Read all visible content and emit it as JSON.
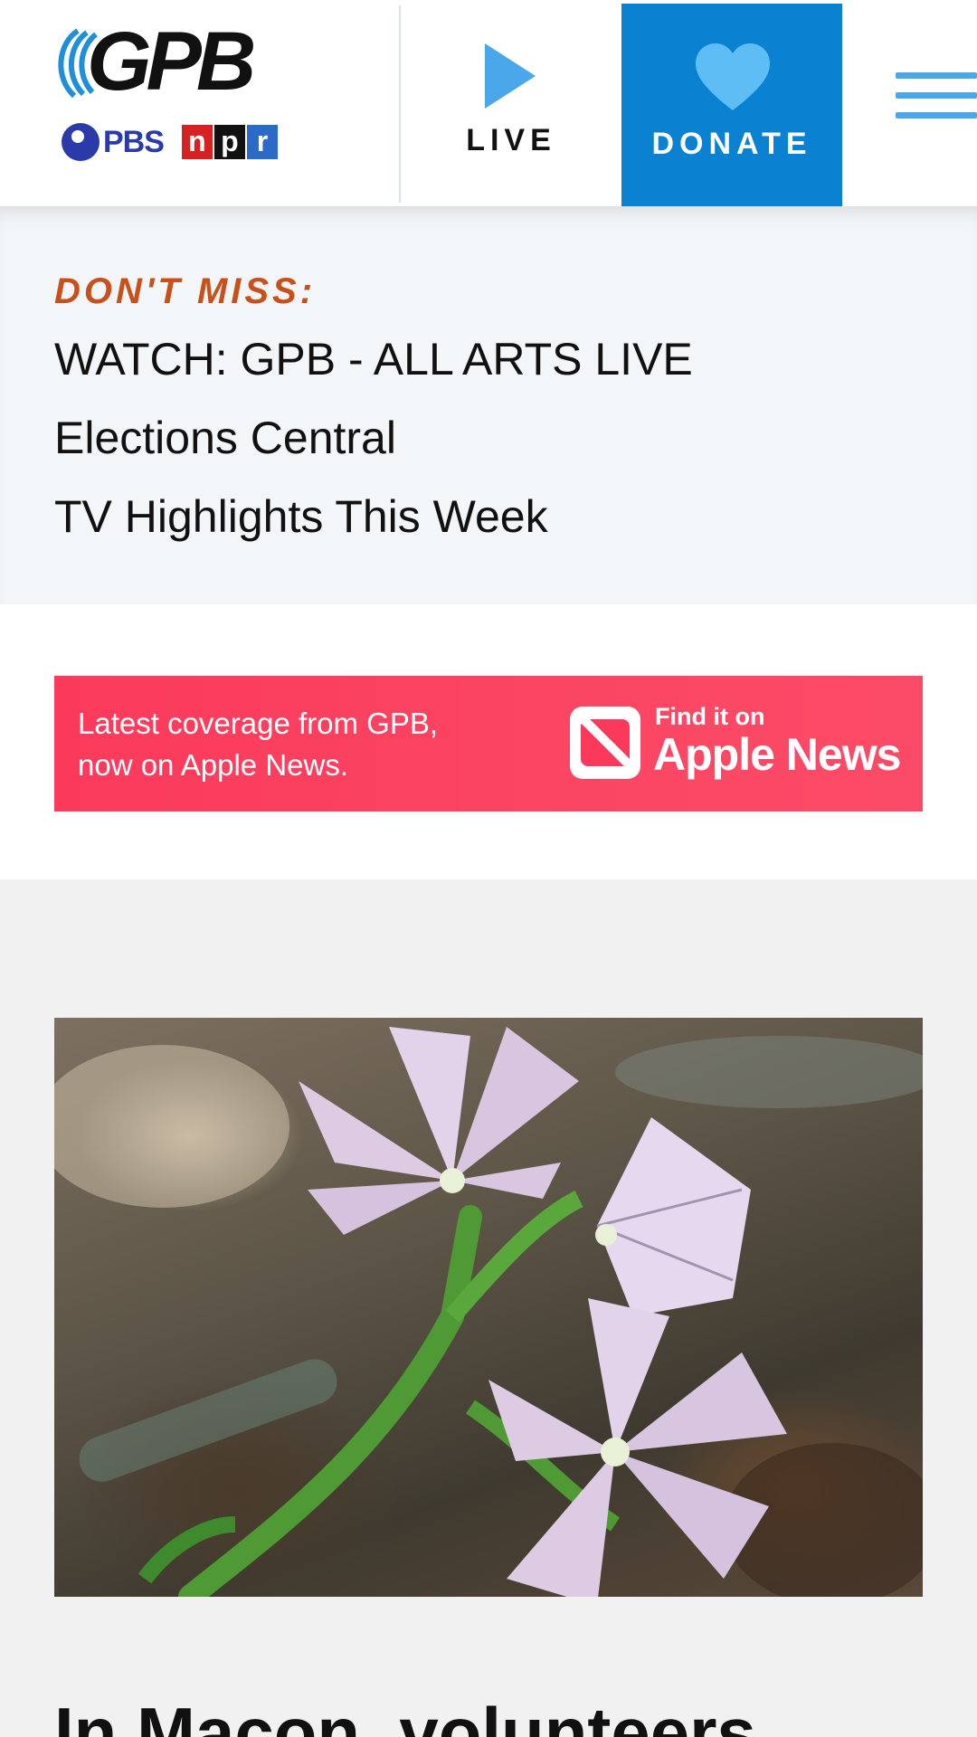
{
  "header": {
    "logo_text": "GPB",
    "partner_pbs": "PBS",
    "partner_npr": [
      "n",
      "p",
      "r"
    ],
    "live_label": "LIVE",
    "donate_label": "DONATE"
  },
  "dont_miss": {
    "heading": "DON'T MISS:",
    "links": [
      "WATCH: GPB - ALL ARTS LIVE",
      "Elections Central",
      "TV Highlights This Week"
    ]
  },
  "apple_banner": {
    "text_line1": "Latest coverage from GPB,",
    "text_line2": "now on Apple News.",
    "find_label": "Find it on",
    "apple_news_label": "Apple News"
  },
  "story": {
    "image_alt": "fringed pink flowers",
    "title": "In Macon, volunteers"
  },
  "colors": {
    "accent_blue": "#4aa8ea",
    "donate_blue": "#0a82d1",
    "dont_miss_orange": "#c8501a",
    "apple_pink": "#fb3a5b"
  }
}
